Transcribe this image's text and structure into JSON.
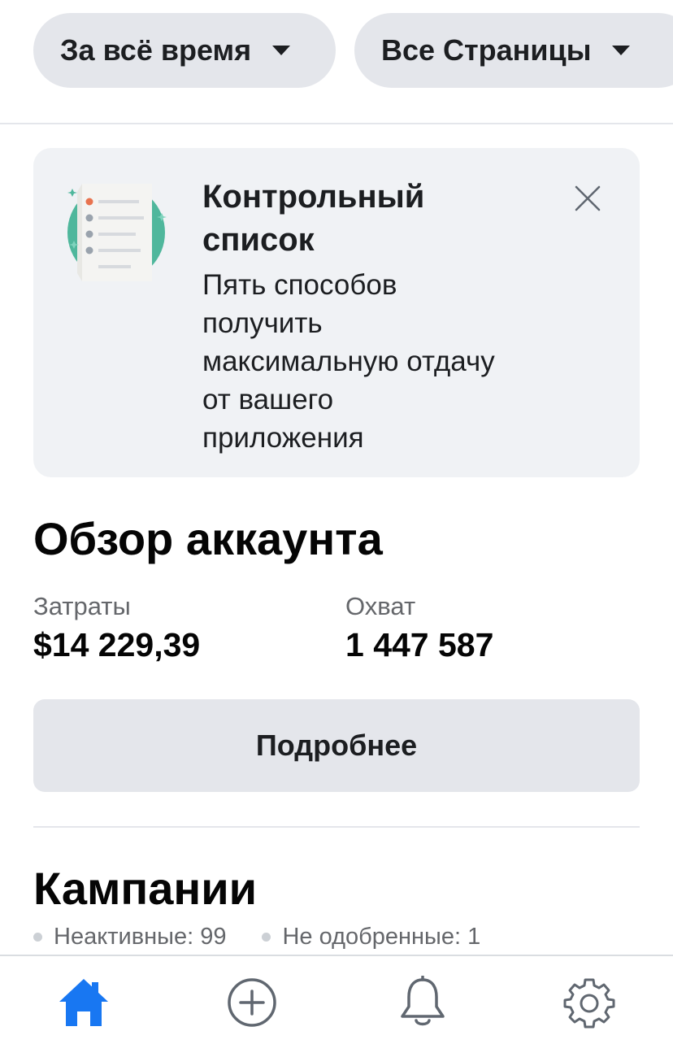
{
  "filters": {
    "time_range": "За всё время",
    "pages": "Все Страницы"
  },
  "checklist": {
    "title": "Контрольный список",
    "description": "Пять способов получить максимальную отдачу от вашего приложения"
  },
  "overview": {
    "title": "Обзор аккаунта",
    "spend_label": "Затраты",
    "spend_value": "$14 229,39",
    "reach_label": "Охват",
    "reach_value": "1 447 587",
    "more_button": "Подробнее"
  },
  "campaigns": {
    "title": "Кампании",
    "inactive": "Неактивные: 99",
    "not_approved": "Не одобренные: 1"
  },
  "nav": {
    "items": [
      "home-icon",
      "plus-circle-icon",
      "bell-icon",
      "gear-icon"
    ],
    "active_color": "#1877f2",
    "inactive_color": "#606770"
  }
}
